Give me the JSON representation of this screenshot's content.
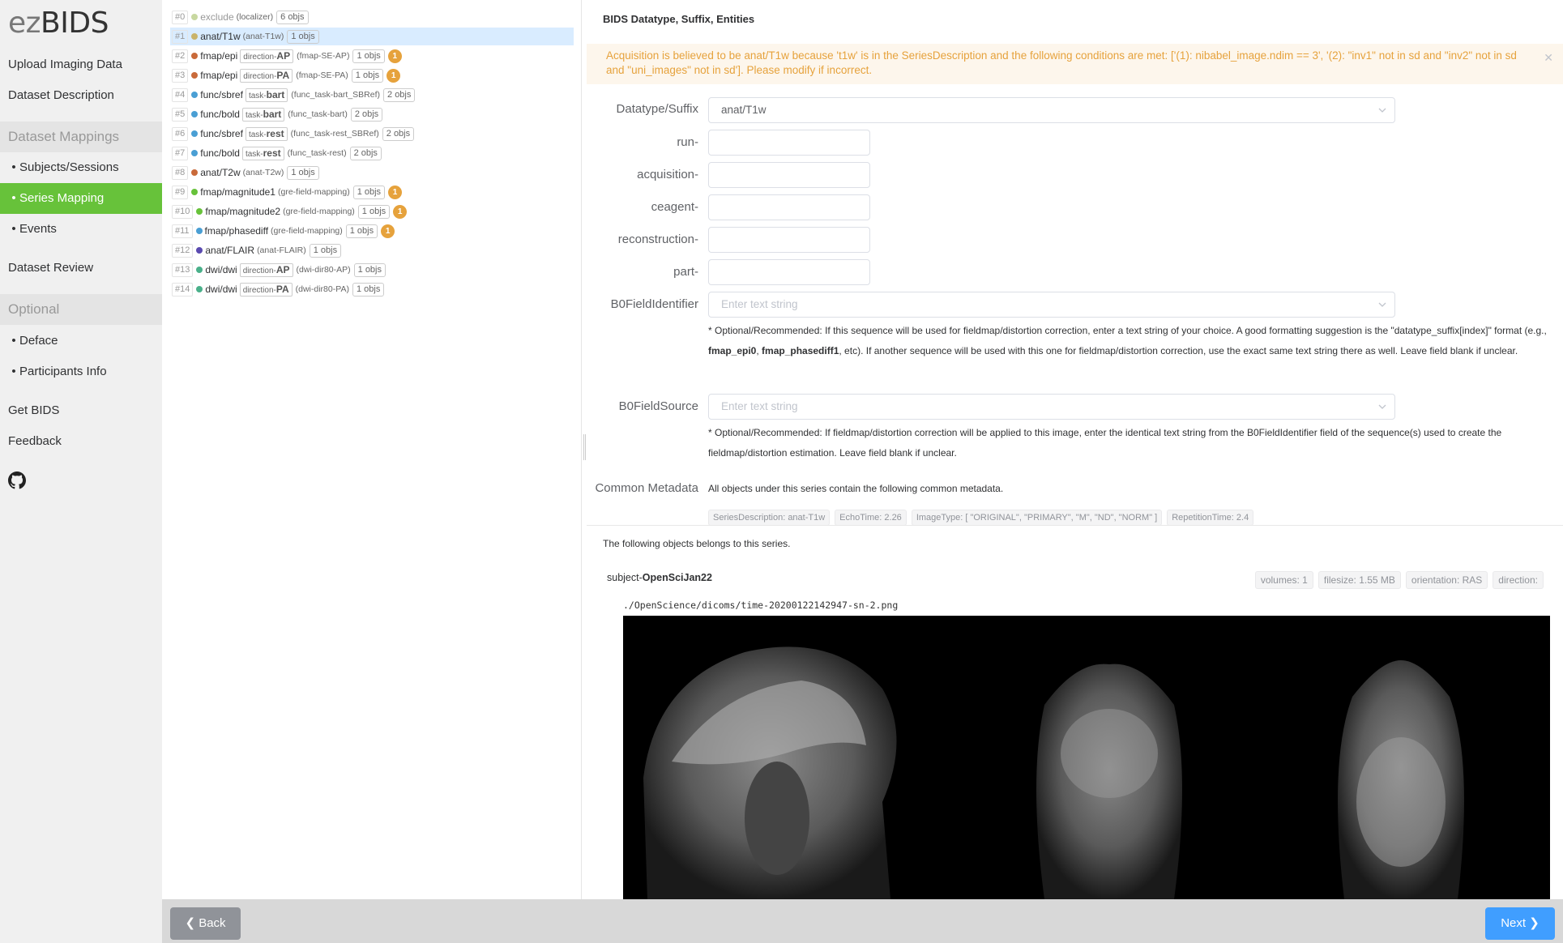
{
  "sidebar": {
    "logo_prefix": "ez",
    "logo_suffix": "BIDS",
    "upload": "Upload Imaging Data",
    "dataset_description": "Dataset Description",
    "section_mappings": "Dataset Mappings",
    "subjects_sessions": "Subjects/Sessions",
    "series_mapping": "Series Mapping",
    "events": "Events",
    "dataset_review": "Dataset Review",
    "section_optional": "Optional",
    "deface": "Deface",
    "participants_info": "Participants Info",
    "get_bids": "Get BIDS",
    "feedback": "Feedback",
    "bullet": "•",
    "github_icon": "github-icon"
  },
  "series": [
    {
      "idx": "#0",
      "type": "exclude",
      "tag_key": "",
      "tag_val": "",
      "desc": "(localizer)",
      "objs": "6 objs",
      "badge": "",
      "dot": "#c8d8a0"
    },
    {
      "idx": "#1",
      "type": "anat/T1w",
      "tag_key": "",
      "tag_val": "",
      "desc": "(anat-T1w)",
      "objs": "1 objs",
      "badge": "",
      "dot": "#c9b36a"
    },
    {
      "idx": "#2",
      "type": "fmap/epi",
      "tag_key": "direction-",
      "tag_val": "AP",
      "desc": "(fmap-SE-AP)",
      "objs": "1 objs",
      "badge": "1",
      "dot": "#c96a3a"
    },
    {
      "idx": "#3",
      "type": "fmap/epi",
      "tag_key": "direction-",
      "tag_val": "PA",
      "desc": "(fmap-SE-PA)",
      "objs": "1 objs",
      "badge": "1",
      "dot": "#c96a3a"
    },
    {
      "idx": "#4",
      "type": "func/sbref",
      "tag_key": "task-",
      "tag_val": "bart",
      "desc": "(func_task-bart_SBRef)",
      "objs": "2 objs",
      "badge": "",
      "dot": "#4a9fd4"
    },
    {
      "idx": "#5",
      "type": "func/bold",
      "tag_key": "task-",
      "tag_val": "bart",
      "desc": "(func_task-bart)",
      "objs": "2 objs",
      "badge": "",
      "dot": "#4a9fd4"
    },
    {
      "idx": "#6",
      "type": "func/sbref",
      "tag_key": "task-",
      "tag_val": "rest",
      "desc": "(func_task-rest_SBRef)",
      "objs": "2 objs",
      "badge": "",
      "dot": "#4a9fd4"
    },
    {
      "idx": "#7",
      "type": "func/bold",
      "tag_key": "task-",
      "tag_val": "rest",
      "desc": "(func_task-rest)",
      "objs": "2 objs",
      "badge": "",
      "dot": "#4a9fd4"
    },
    {
      "idx": "#8",
      "type": "anat/T2w",
      "tag_key": "",
      "tag_val": "",
      "desc": "(anat-T2w)",
      "objs": "1 objs",
      "badge": "",
      "dot": "#c96a3a"
    },
    {
      "idx": "#9",
      "type": "fmap/magnitude1",
      "tag_key": "",
      "tag_val": "",
      "desc": "(gre-field-mapping)",
      "objs": "1 objs",
      "badge": "1",
      "dot": "#67c23a"
    },
    {
      "idx": "#10",
      "type": "fmap/magnitude2",
      "tag_key": "",
      "tag_val": "",
      "desc": "(gre-field-mapping)",
      "objs": "1 objs",
      "badge": "1",
      "dot": "#67c23a"
    },
    {
      "idx": "#11",
      "type": "fmap/phasediff",
      "tag_key": "",
      "tag_val": "",
      "desc": "(gre-field-mapping)",
      "objs": "1 objs",
      "badge": "1",
      "dot": "#4a9fd4"
    },
    {
      "idx": "#12",
      "type": "anat/FLAIR",
      "tag_key": "",
      "tag_val": "",
      "desc": "(anat-FLAIR)",
      "objs": "1 objs",
      "badge": "",
      "dot": "#5a4ab0"
    },
    {
      "idx": "#13",
      "type": "dwi/dwi",
      "tag_key": "direction-",
      "tag_val": "AP",
      "desc": "(dwi-dir80-AP)",
      "objs": "1 objs",
      "badge": "",
      "dot": "#4ab08a"
    },
    {
      "idx": "#14",
      "type": "dwi/dwi",
      "tag_key": "direction-",
      "tag_val": "PA",
      "desc": "(dwi-dir80-PA)",
      "objs": "1 objs",
      "badge": "",
      "dot": "#4ab08a"
    }
  ],
  "detail": {
    "header": "BIDS Datatype, Suffix, Entities",
    "alert": "Acquisition is believed to be anat/T1w because 't1w' is in the SeriesDescription and the following conditions are met: ['(1): nibabel_image.ndim == 3', '(2): \"inv1\" not in sd and \"inv2\" not in sd and \"uni_images\" not in sd']. Please modify if incorrect.",
    "datatype_label": "Datatype/Suffix",
    "datatype_value": "anat/T1w",
    "run_label": "run-",
    "acquisition_label": "acquisition-",
    "ceagent_label": "ceagent-",
    "reconstruction_label": "reconstruction-",
    "part_label": "part-",
    "b0id_label": "B0FieldIdentifier",
    "b0id_placeholder": "Enter text string",
    "b0id_note_1": "* Optional/Recommended: If this sequence will be used for fieldmap/distortion correction, enter a text string of your choice. A good formatting suggestion is the \"datatype_suffix[index]\" format (e.g., ",
    "b0id_note_bold1": "fmap_epi0",
    "b0id_note_sep": ", ",
    "b0id_note_bold2": "fmap_phasediff1",
    "b0id_note_2": ", etc). If another sequence will be used with this one for fieldmap/distortion correction, use the exact same text string there as well. Leave field blank if unclear.",
    "b0src_label": "B0FieldSource",
    "b0src_placeholder": "Enter text string",
    "b0src_note": "* Optional/Recommended: If fieldmap/distortion correction will be applied to this image, enter the identical text string from the B0FieldIdentifier field of the sequence(s) used to create the fieldmap/distortion estimation. Leave field blank if unclear.",
    "common_meta_label": "Common Metadata",
    "common_meta_text": "All objects under this series contain the following common metadata.",
    "meta_tags": [
      "SeriesDescription: anat-T1w",
      "EchoTime: 2.26",
      "ImageType: [ \"ORIGINAL\", \"PRIMARY\", \"M\", \"ND\", \"NORM\" ]",
      "RepetitionTime: 2.4"
    ],
    "objects_text": "The following objects belongs to this series.",
    "subject_prefix": "subject-",
    "subject_name": "OpenSciJan22",
    "obj_tags": [
      "volumes: 1",
      "filesize: 1.55 MB",
      "orientation: RAS",
      "direction:"
    ],
    "image_path": "./OpenScience/dicoms/time-20200122142947-sn-2.png"
  },
  "footer": {
    "back": "Back",
    "next": "Next"
  },
  "colors": {
    "active_green": "#67c23a",
    "selected_blue": "#d9ecff",
    "warning": "#e6a23c",
    "primary": "#409eff"
  }
}
